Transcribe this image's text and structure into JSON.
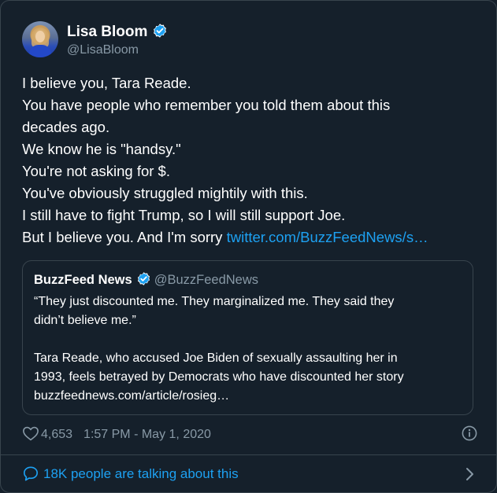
{
  "author": {
    "name": "Lisa Bloom",
    "handle": "@LisaBloom",
    "verified_icon": "verified-badge-icon"
  },
  "tweet": {
    "lines": [
      "I believe you, Tara Reade.",
      "You have people who remember you told them about this",
      "decades ago.",
      "We know he is \"handsy.\"",
      "You're not asking for $.",
      "You've obviously struggled mightily with this.",
      "I still have to fight Trump, so I will still support Joe.",
      "But I believe you. And I'm sorry "
    ],
    "link": "twitter.com/BuzzFeedNews/s…"
  },
  "quote": {
    "name": "BuzzFeed News",
    "handle": "@BuzzFeedNews",
    "lines_1": [
      "“They just discounted me. They marginalized me. They said they",
      "didn’t believe me.”"
    ],
    "lines_2": [
      "Tara Reade, who accused Joe Biden of sexually assaulting her in",
      "1993, feels betrayed by Democrats who have discounted her story",
      "buzzfeednews.com/article/rosieg…"
    ]
  },
  "meta": {
    "likes": "4,653",
    "timestamp": "1:57 PM - May 1, 2020"
  },
  "footer": {
    "talking": "18K people are talking about this"
  },
  "colors": {
    "background": "#15202b",
    "border": "#38444d",
    "accent": "#1da1f2",
    "muted": "#8899a6",
    "text": "#ffffff"
  }
}
